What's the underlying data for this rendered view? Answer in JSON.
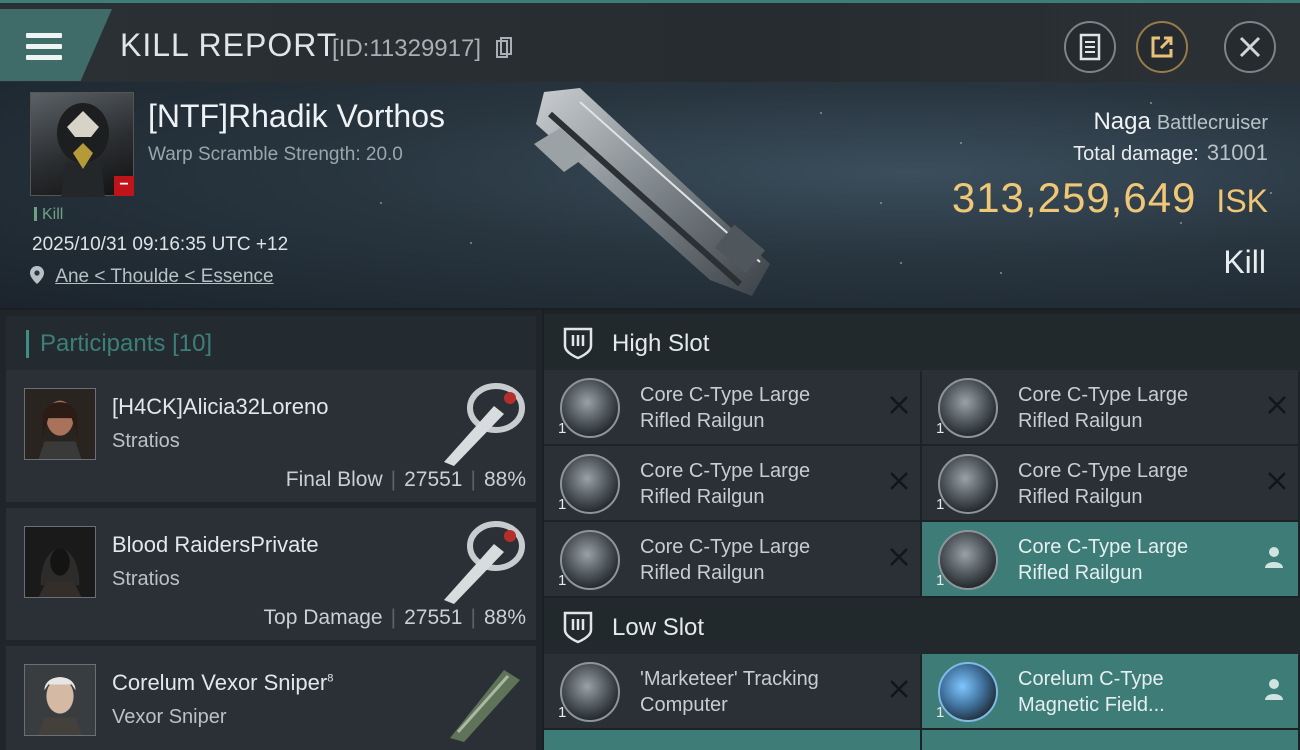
{
  "header": {
    "title": "KILL REPORT",
    "id_text": "[ID:11329917]"
  },
  "victim": {
    "name": "[NTF]Rhadik Vorthos",
    "warp_scramble": "Warp Scramble Strength: 20.0",
    "kill_tag": "Kill",
    "datetime": "2025/10/31 09:16:35 UTC +12",
    "location": "Ane < Thoulde < Essence",
    "ship_name": "Naga",
    "ship_class": "Battlecruiser",
    "total_damage_label": "Total damage:",
    "total_damage_value": "31001",
    "isk_value": "313,259,649",
    "isk_unit": "ISK",
    "result": "Kill"
  },
  "participants": {
    "title": "Participants",
    "count": "[10]",
    "rows": [
      {
        "name": "[H4CK]Alicia32Loreno",
        "ship": "Stratios",
        "role": "Final Blow",
        "damage": "27551",
        "percent": "88%"
      },
      {
        "name": "Blood RaidersPrivate",
        "ship": "Stratios",
        "role": "Top Damage",
        "damage": "27551",
        "percent": "88%"
      },
      {
        "name": "Corelum Vexor Sniper",
        "name_sup": "8",
        "ship": "Vexor Sniper"
      }
    ]
  },
  "fitting": {
    "high_slot_title": "High Slot",
    "low_slot_title": "Low Slot",
    "high_modules": [
      {
        "line1": "Core C-Type Large",
        "line2": "Rifled Railgun",
        "qty": "1",
        "state": "destroyed"
      },
      {
        "line1": "Core C-Type Large",
        "line2": "Rifled Railgun",
        "qty": "1",
        "state": "destroyed"
      },
      {
        "line1": "Core C-Type Large",
        "line2": "Rifled Railgun",
        "qty": "1",
        "state": "destroyed"
      },
      {
        "line1": "Core C-Type Large",
        "line2": "Rifled Railgun",
        "qty": "1",
        "state": "destroyed"
      },
      {
        "line1": "Core C-Type Large",
        "line2": "Rifled Railgun",
        "qty": "1",
        "state": "destroyed"
      },
      {
        "line1": "Core C-Type Large",
        "line2": "Rifled Railgun",
        "qty": "1",
        "state": "dropped"
      }
    ],
    "low_modules": [
      {
        "line1": "'Marketeer' Tracking",
        "line2": "Computer",
        "qty": "1",
        "state": "destroyed"
      },
      {
        "line1": "Corelum C-Type",
        "line2": "Magnetic Field...",
        "qty": "1",
        "state": "dropped"
      }
    ]
  },
  "icons": {
    "menu": "hamburger-icon",
    "copy": "copy-icon",
    "notes": "notes-icon",
    "share": "share-icon",
    "close": "close-icon",
    "location": "location-pin-icon",
    "slot": "shield-slot-icon",
    "destroyed": "x-icon",
    "dropped": "person-icon"
  },
  "colors": {
    "accent": "#3d7f78",
    "isk": "#f0c776",
    "negative": "#c0141a"
  }
}
